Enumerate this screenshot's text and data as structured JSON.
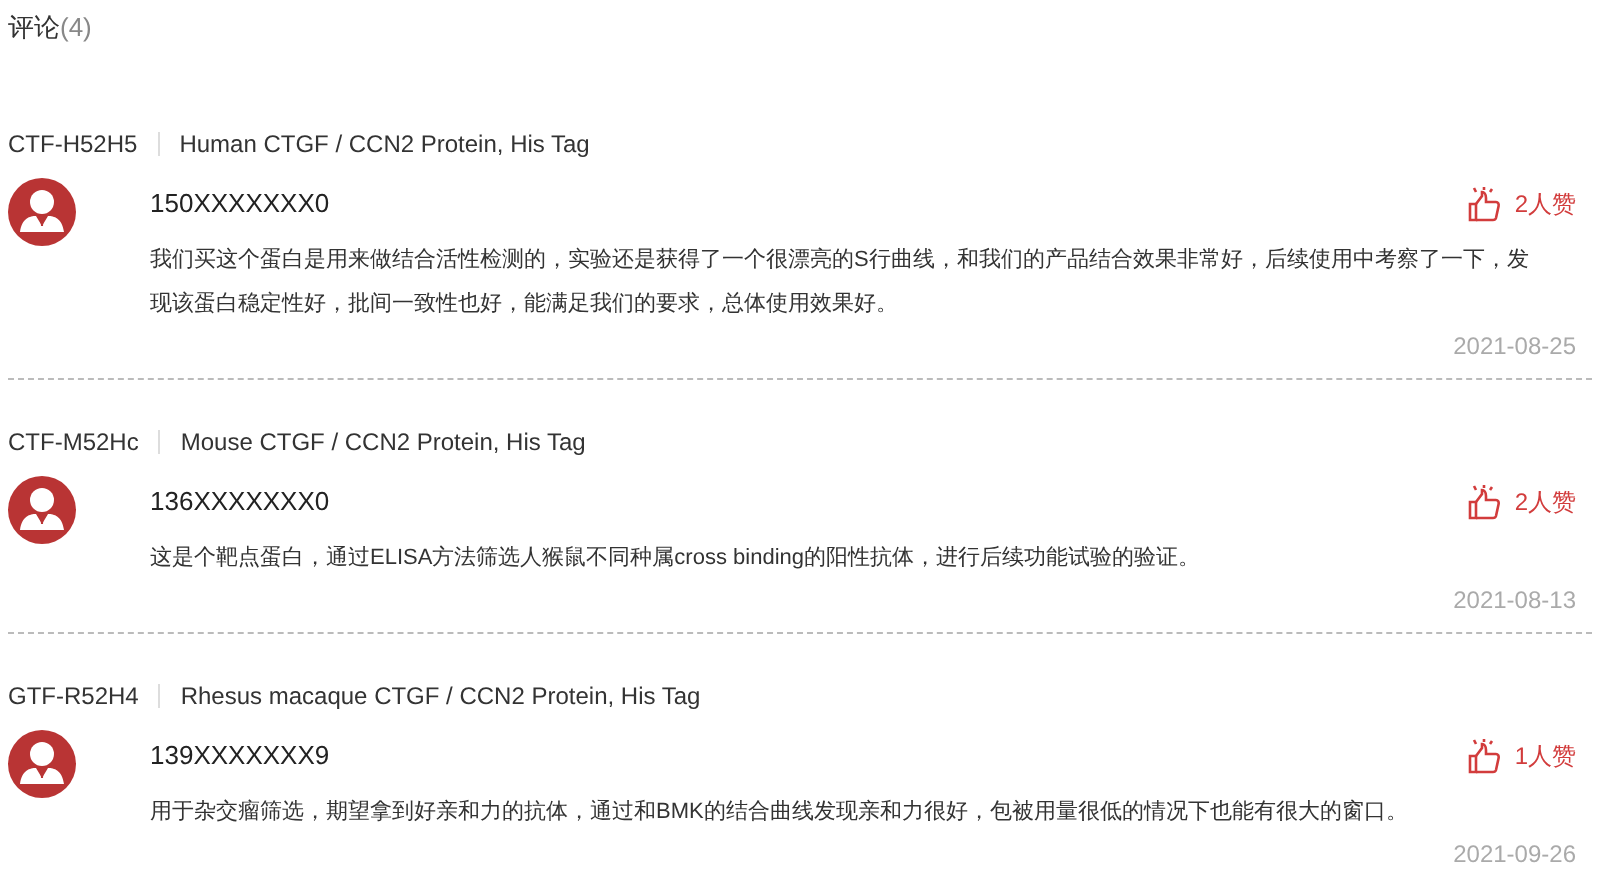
{
  "title": "评论",
  "count": "(4)",
  "reviews": [
    {
      "product_code": "CTF-H52H5",
      "product_name": "Human CTGF / CCN2 Protein, His Tag",
      "user": "150XXXXXXX0",
      "likes": "2人赞",
      "text": "我们买这个蛋白是用来做结合活性检测的，实验还是获得了一个很漂亮的S行曲线，和我们的产品结合效果非常好，后续使用中考察了一下，发现该蛋白稳定性好，批间一致性也好，能满足我们的要求，总体使用效果好。",
      "date": "2021-08-25"
    },
    {
      "product_code": "CTF-M52Hc",
      "product_name": "Mouse CTGF / CCN2 Protein, His Tag",
      "user": "136XXXXXXX0",
      "likes": "2人赞",
      "text": "这是个靶点蛋白，通过ELISA方法筛选人猴鼠不同种属cross binding的阳性抗体，进行后续功能试验的验证。",
      "date": "2021-08-13"
    },
    {
      "product_code": "GTF-R52H4",
      "product_name": "Rhesus macaque CTGF / CCN2 Protein, His Tag",
      "user": "139XXXXXXX9",
      "likes": "1人赞",
      "text": "用于杂交瘤筛选，期望拿到好亲和力的抗体，通过和BMK的结合曲线发现亲和力很好，包被用量很低的情况下也能有很大的窗口。",
      "date": "2021-09-26"
    }
  ]
}
